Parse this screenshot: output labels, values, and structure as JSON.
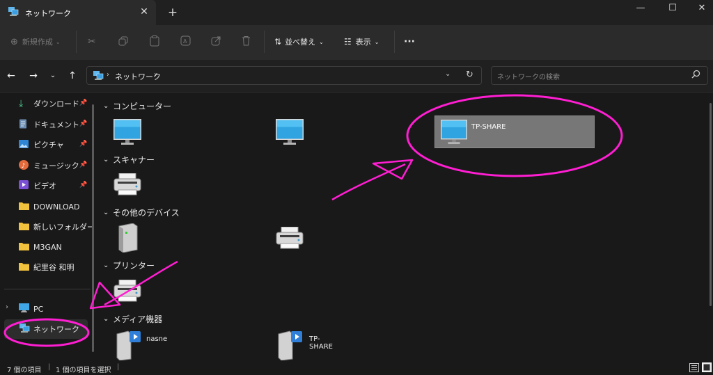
{
  "window": {
    "tab_title": "ネットワーク",
    "tab_close": "✕",
    "new_tab": "+",
    "min": "—",
    "max": "☐",
    "close": "✕"
  },
  "toolbar": {
    "new_label": "新規作成",
    "sort_label": "並べ替え",
    "view_label": "表示",
    "more": "···"
  },
  "address": {
    "path": "ネットワーク",
    "search_placeholder": "ネットワークの検索"
  },
  "sidebar": {
    "quick_access": [
      {
        "label": "ダウンロード",
        "icon": "download-icon",
        "pinned": true
      },
      {
        "label": "ドキュメント",
        "icon": "document-icon",
        "pinned": true
      },
      {
        "label": "ピクチャ",
        "icon": "picture-icon",
        "pinned": true
      },
      {
        "label": "ミュージック",
        "icon": "music-icon",
        "pinned": true
      },
      {
        "label": "ビデオ",
        "icon": "video-icon",
        "pinned": true
      },
      {
        "label": "DOWNLOAD",
        "icon": "folder-icon",
        "pinned": false
      },
      {
        "label": "新しいフォルダー",
        "icon": "folder-icon",
        "pinned": false
      },
      {
        "label": "M3GAN",
        "icon": "folder-icon",
        "pinned": false
      },
      {
        "label": "紀里谷 和明",
        "icon": "folder-icon",
        "pinned": false
      }
    ],
    "pc_label": "PC",
    "network_label": "ネットワーク"
  },
  "groups": {
    "computers": "コンピューター",
    "scanners": "スキャナー",
    "other_devices": "その他のデバイス",
    "printers": "プリンター",
    "media": "メディア機器"
  },
  "items": {
    "computer3": "TP-SHARE",
    "media1": "nasne",
    "media2": "TP-SHARE"
  },
  "status": {
    "count": "7 個の項目",
    "selected": "1 個の項目を選択"
  },
  "colors": {
    "accent": "#60cdff",
    "annotation": "#ff1ed2",
    "folder": "#f3c23c"
  }
}
